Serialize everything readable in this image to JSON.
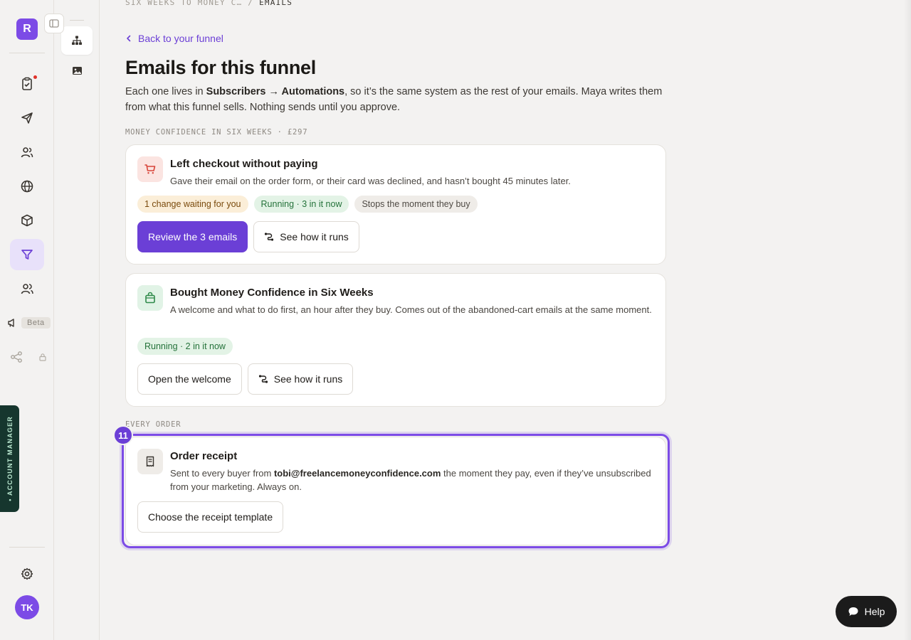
{
  "rail": {
    "logo_letter": "R",
    "beta_label": "Beta",
    "account_manager_label": "• ACCOUNT MANAGER",
    "avatar_initials": "TK"
  },
  "breadcrumb": {
    "parent": "SIX WEEKS TO MONEY C…",
    "separator": "/",
    "current": "EMAILS"
  },
  "back_link": "Back to your funnel",
  "page_title": "Emails for this funnel",
  "intro": {
    "part1": "Each one lives in ",
    "subscribers": "Subscribers",
    "arrow": " → ",
    "automations": "Automations",
    "part2": ", so it’s the same system as the rest of your emails. Maya writes them from what this funnel sells. Nothing sends until you approve."
  },
  "sections": {
    "product_label": "MONEY CONFIDENCE IN SIX WEEKS · £297",
    "every_order_label": "EVERY ORDER"
  },
  "cards": {
    "abandoned": {
      "title": "Left checkout without paying",
      "description": "Gave their email on the order form, or their card was declined, and hasn’t bought 45 minutes later.",
      "chips": [
        "1 change waiting for you",
        "Running · 3 in it now",
        "Stops the moment they buy"
      ],
      "primary_button": "Review the 3 emails",
      "secondary_button": "See how it runs"
    },
    "bought": {
      "title": "Bought Money Confidence in Six Weeks",
      "description": "A welcome and what to do first, an hour after they buy. Comes out of the abandoned-cart emails at the same moment.",
      "chips": [
        "Running · 2 in it now"
      ],
      "button_open": "Open the welcome",
      "button_see": "See how it runs"
    },
    "receipt": {
      "title": "Order receipt",
      "desc_part1": "Sent to every buyer from ",
      "email": "tobi@freelancemoneyconfidence.com",
      "desc_part2": " the moment they pay, even if they’ve unsubscribed from your marketing. Always on.",
      "button": "Choose the receipt template"
    }
  },
  "step_badge": "11",
  "help_label": "Help",
  "colors": {
    "accent": "#6b3fd6",
    "running_green": "#24723a",
    "pending_amber": "#7a4a0c"
  },
  "icons": {
    "rail": [
      "checklist-icon",
      "send-icon",
      "people-icon",
      "globe-icon",
      "box-icon",
      "filter-icon",
      "users-icon",
      "megaphone-icon",
      "share-icon",
      "lock-icon",
      "gear-icon"
    ],
    "subrail": [
      "sitemap-icon",
      "image-icon"
    ]
  }
}
